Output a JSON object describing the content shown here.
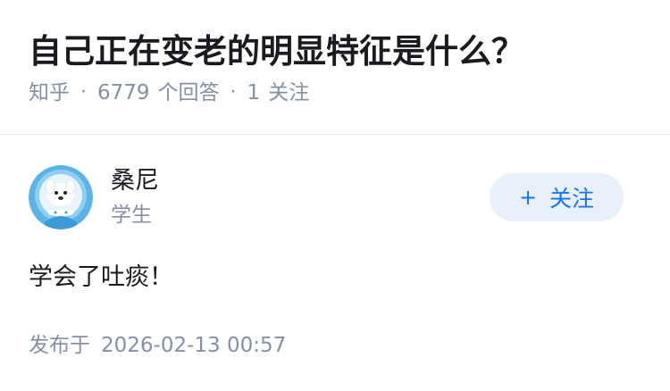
{
  "question": {
    "title": "自己正在变老的明显特征是什么？",
    "source": "知乎",
    "answer_count": "6779",
    "answer_label": "个回答",
    "follow_count": "1",
    "follow_label": "关注"
  },
  "answer": {
    "author_name": "桑尼",
    "author_bio": "学生",
    "follow_button_label": "关注",
    "content": "学会了吐痰！",
    "publish_label": "发布于",
    "publish_date": "2026-02-13 00:57"
  },
  "colors": {
    "title": "#191b1f",
    "meta": "#8590a6",
    "accent": "#1772f6",
    "follow_bg": "#e7f0fb"
  },
  "icons": {
    "avatar": "dog-astronaut-avatar",
    "follow": "plus-icon"
  }
}
